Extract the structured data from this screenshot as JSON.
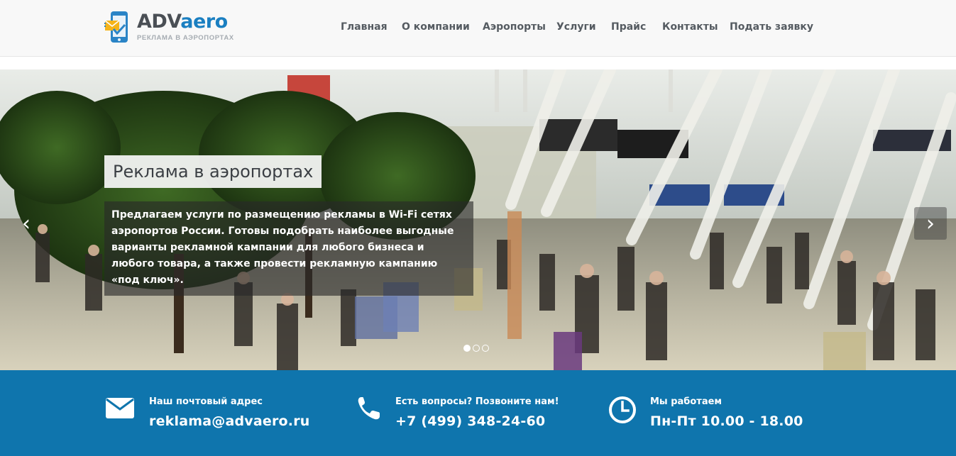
{
  "header": {
    "logo": {
      "name_part1": "ADV",
      "name_part2": "aero",
      "tagline": "РЕКЛАМА В АЭРОПОРТАХ",
      "icon": "phone-ad-logo-icon"
    },
    "nav": [
      {
        "label": "Главная"
      },
      {
        "label": "О компании"
      },
      {
        "label": "Аэропорты"
      },
      {
        "label": "Услуги"
      },
      {
        "label": "Прайс"
      },
      {
        "label": "Контакты"
      },
      {
        "label": "Подать заявку"
      }
    ]
  },
  "hero": {
    "title": "Реклама в аэропортах",
    "text": "Предлагаем услуги по размещению рекламы в Wi-Fi сетях аэропортов России. Готовы подобрать наиболее выгодные варианты рекламной кампании для любого бизнеса и любого товара, а также провести рекламную кампанию «под ключ».",
    "prev_icon": "chevron-left-icon",
    "next_icon": "chevron-right-icon",
    "slides_count": 3,
    "active_slide": 1
  },
  "infobar": {
    "email": {
      "label": "Наш почтовый адрес",
      "value": "reklama@advaero.ru",
      "icon": "envelope-icon"
    },
    "phone": {
      "label": "Есть вопросы? Позвоните нам!",
      "value": "+7 (499) 348-24-60",
      "icon": "phone-icon"
    },
    "hours": {
      "label": "Мы работаем",
      "value": "Пн-Пт 10.00 - 18.00",
      "icon": "clock-icon"
    }
  },
  "colors": {
    "brand_blue": "#1a7fc1",
    "infobar_bg": "#0f75ad",
    "nav_text": "#555b61",
    "header_bg": "#f8f8f8"
  }
}
